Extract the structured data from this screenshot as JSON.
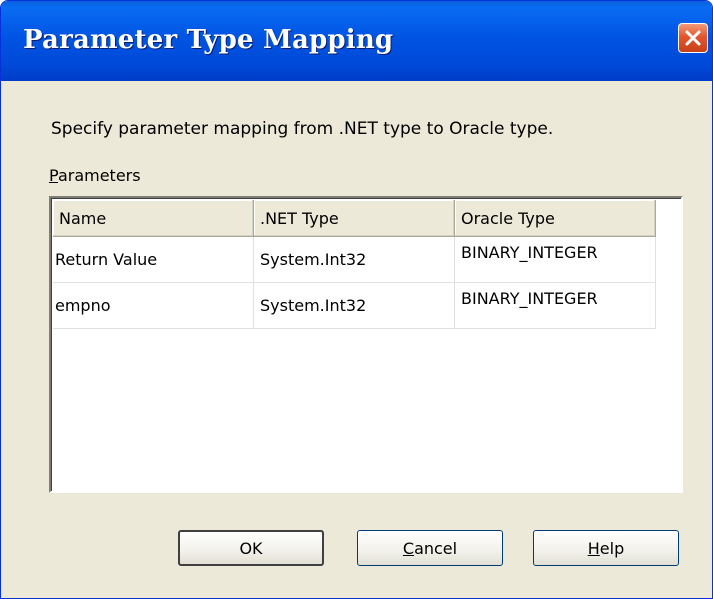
{
  "window": {
    "title": "Parameter Type Mapping"
  },
  "instruction": "Specify parameter mapping from .NET type to Oracle type.",
  "group": {
    "label_underlined": "P",
    "label_rest": "arameters"
  },
  "table": {
    "columns": [
      "Name",
      ".NET Type",
      "Oracle Type"
    ],
    "rows": [
      {
        "name": "Return Value",
        "net_type": "System.Int32",
        "oracle_type": "BINARY_INTEGER"
      },
      {
        "name": "empno",
        "net_type": "System.Int32",
        "oracle_type": "BINARY_INTEGER"
      }
    ]
  },
  "buttons": {
    "ok": "OK",
    "cancel_underlined": "C",
    "cancel_rest": "ancel",
    "help_underlined": "H",
    "help_rest": "elp"
  },
  "icons": {
    "close": "close-icon"
  },
  "colors": {
    "titlebar": "#0054e3",
    "close": "#e2572d",
    "dialog_bg": "#ece9d8"
  }
}
